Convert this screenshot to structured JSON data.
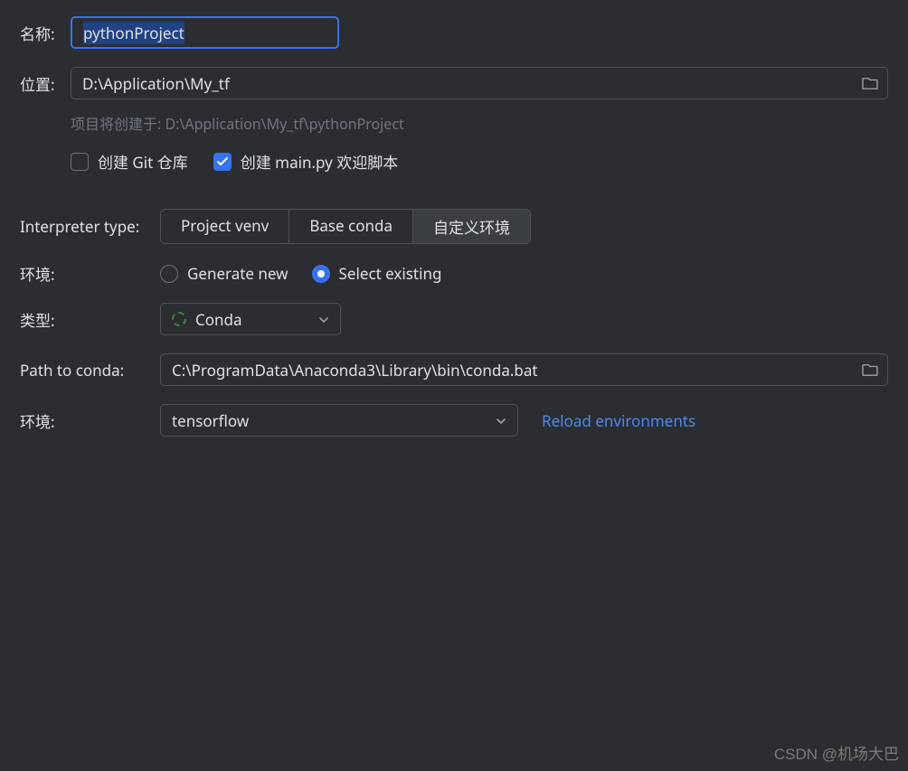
{
  "name": {
    "label": "名称:",
    "value": "pythonProject"
  },
  "location": {
    "label": "位置:",
    "value": "D:\\Application\\My_tf"
  },
  "helper": {
    "prefix": "项目将创建于: ",
    "path": "D:\\Application\\My_tf\\pythonProject"
  },
  "checkboxes": {
    "git_label": "创建 Git 仓库",
    "git_checked": false,
    "mainpy_label": "创建 main.py 欢迎脚本",
    "mainpy_checked": true
  },
  "interpreter": {
    "label": "Interpreter type:",
    "options": [
      "Project venv",
      "Base conda",
      "自定义环境"
    ],
    "selected_index": 2
  },
  "env_mode": {
    "label": "环境:",
    "options": [
      "Generate new",
      "Select existing"
    ],
    "selected_index": 1
  },
  "type_select": {
    "label": "类型:",
    "value": "Conda"
  },
  "conda_path": {
    "label": "Path to conda:",
    "value": "C:\\ProgramData\\Anaconda3\\Library\\bin\\conda.bat"
  },
  "env_select": {
    "label": "环境:",
    "value": "tensorflow",
    "reload_label": "Reload environments"
  },
  "watermark": "CSDN @机场大巴"
}
